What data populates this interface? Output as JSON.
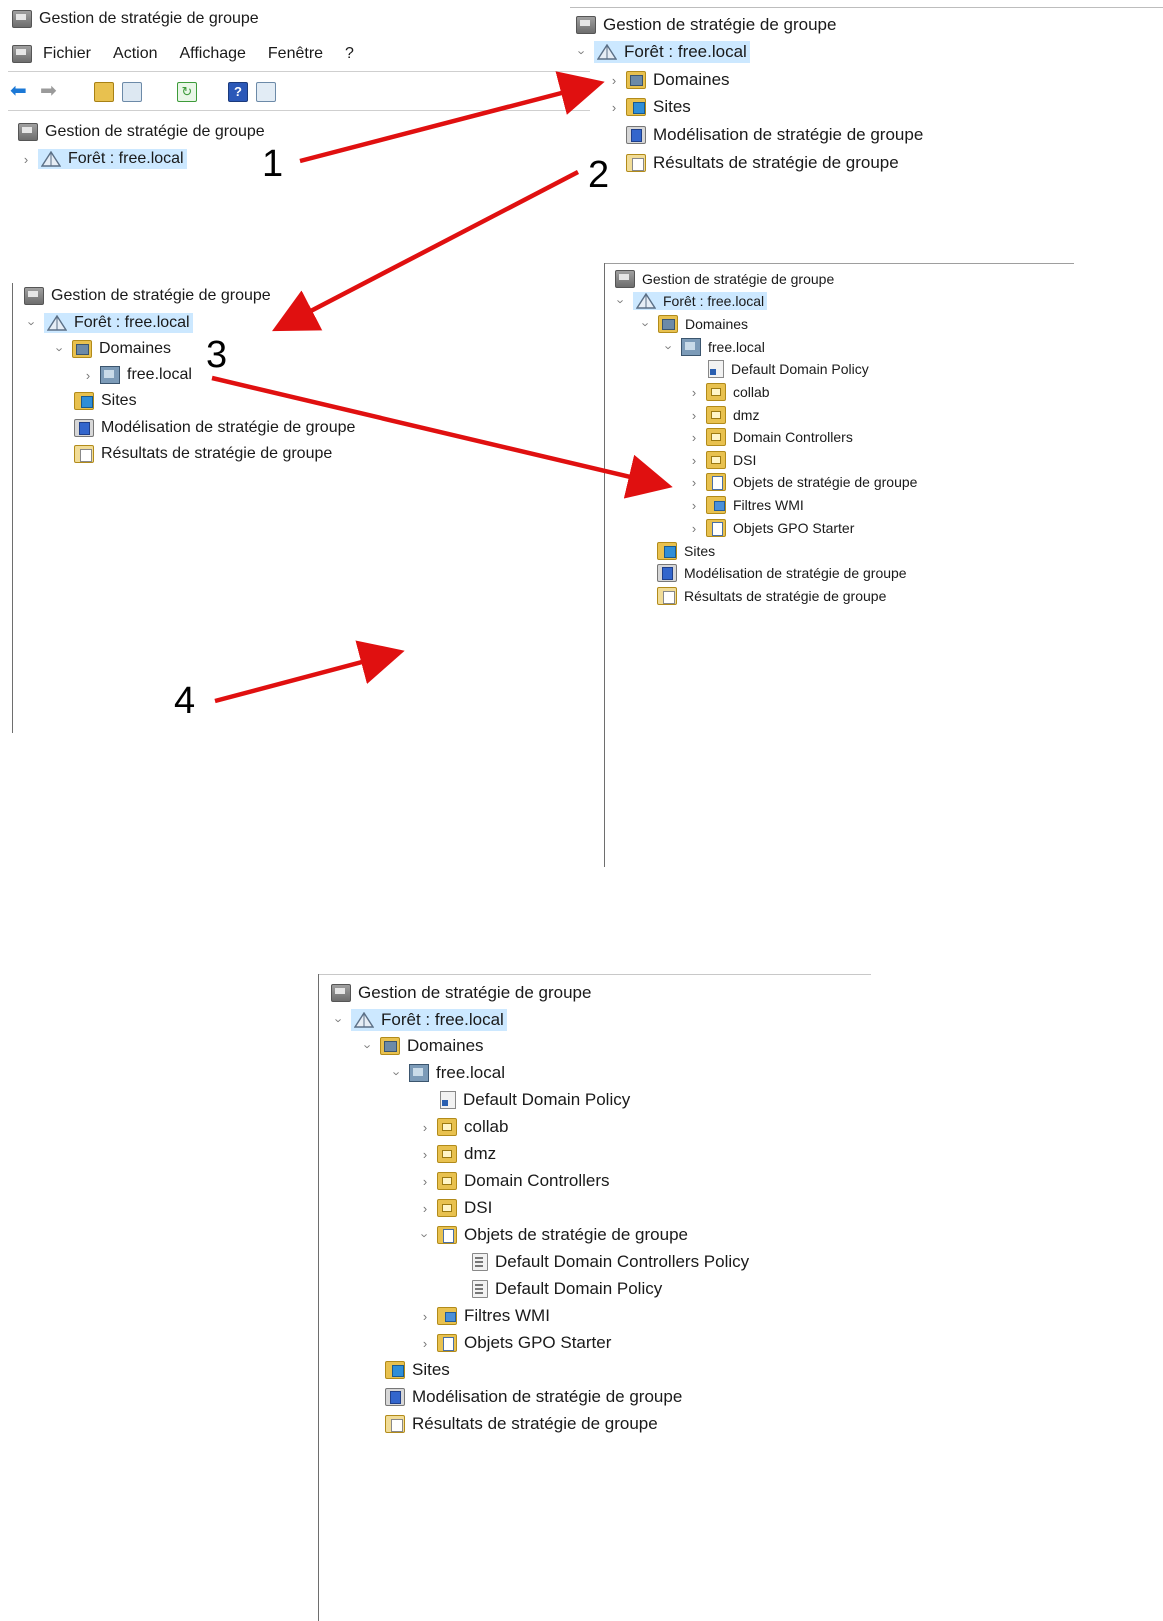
{
  "title": "Gestion de stratégie de groupe",
  "menu": [
    "Fichier",
    "Action",
    "Affichage",
    "Fenêtre",
    "?"
  ],
  "tree": {
    "root": "Gestion de stratégie de groupe",
    "forest": "Forêt : free.local",
    "domains": "Domaines",
    "domain": "free.local",
    "default_domain_policy": "Default Domain Policy",
    "ous": [
      "collab",
      "dmz",
      "Domain Controllers",
      "DSI"
    ],
    "gpo_container": "Objets de stratégie de groupe",
    "gpo_items": [
      "Default Domain Controllers Policy",
      "Default Domain Policy"
    ],
    "wmi": "Filtres WMI",
    "starter": "Objets GPO Starter",
    "sites": "Sites",
    "modeling": "Modélisation de stratégie de groupe",
    "results": "Résultats de stratégie de groupe"
  },
  "steps": [
    "1",
    "2",
    "3",
    "4"
  ],
  "arrow_color": "#e01010",
  "selection_color": "#cce8ff"
}
